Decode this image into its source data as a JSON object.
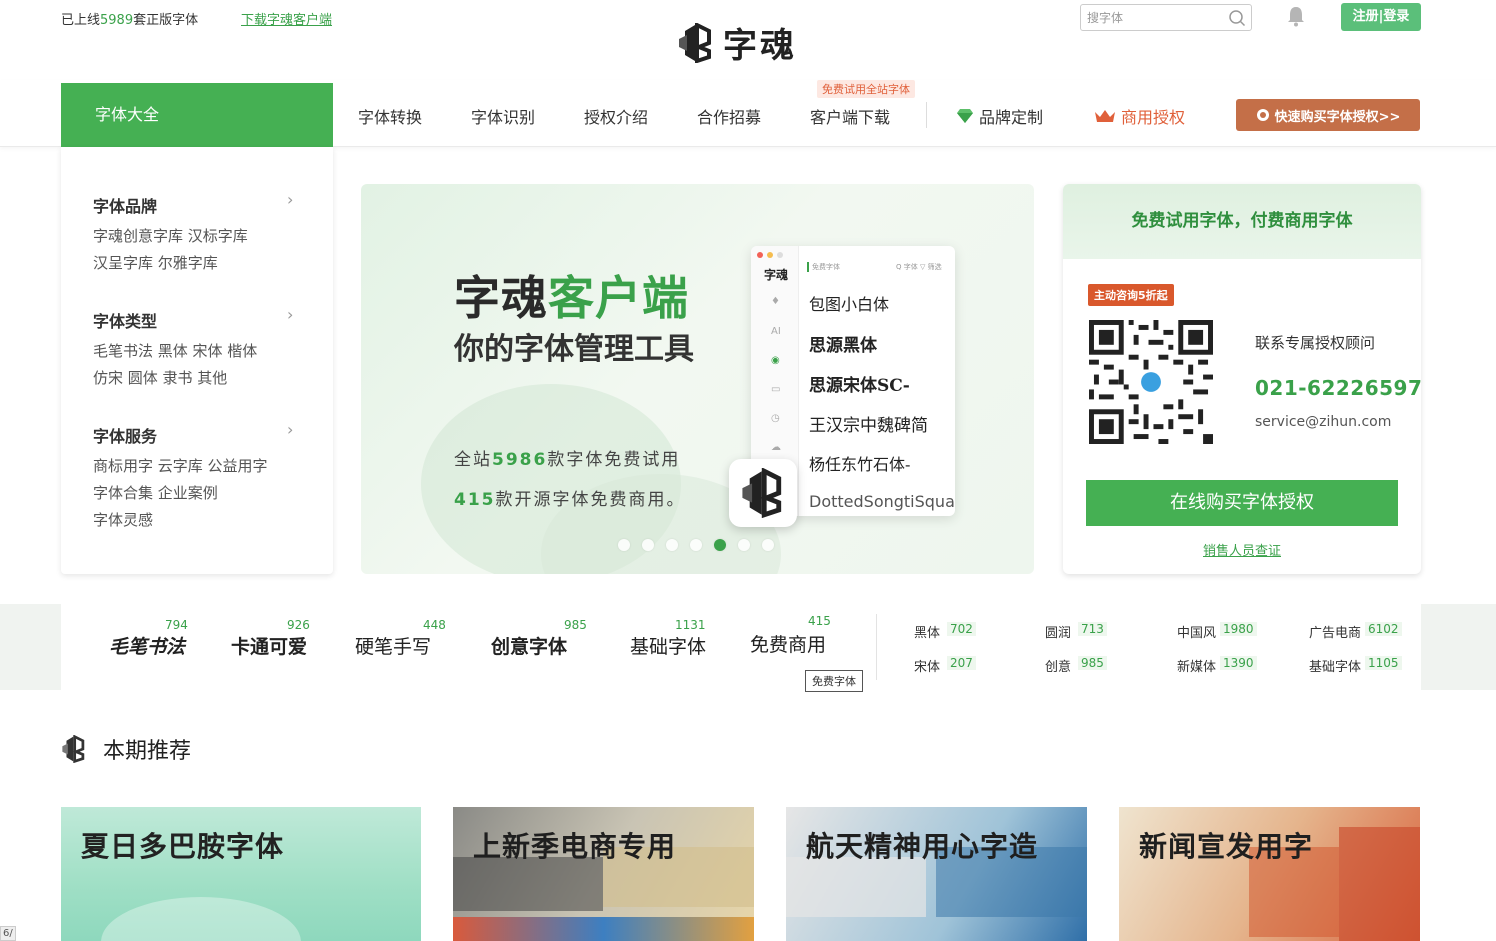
{
  "topbar": {
    "tagline_prefix": "已上线",
    "tagline_count": "5989",
    "tagline_suffix": "套正版字体",
    "download_link": "下载字魂客户端",
    "logo_text": "字魂",
    "search_placeholder": "搜字体",
    "login_label": "注册|登录"
  },
  "nav": {
    "main": "字体大全",
    "items": [
      "字体转换",
      "字体识别",
      "授权介绍",
      "合作招募",
      "客户端下载"
    ],
    "badge": "免费试用全站字体",
    "brand": "品牌定制",
    "commercial": "商用授权",
    "buy": "快速购买字体授权>>"
  },
  "categories": [
    {
      "title": "字体品牌",
      "lines": [
        "字魂创意字库 汉标字库",
        "汉呈字库 尔雅字库"
      ]
    },
    {
      "title": "字体类型",
      "lines": [
        "毛笔书法 黑体 宋体 楷体",
        "仿宋 圆体 隶书 其他"
      ]
    },
    {
      "title": "字体服务",
      "lines": [
        "商标用字 云字库 公益用字",
        "字体合集 企业案例",
        "字体灵感"
      ]
    }
  ],
  "banner": {
    "title_a": "字魂",
    "title_b": "客户端",
    "subtitle": "你的字体管理工具",
    "line1_a": "全站",
    "line1_num": "5986",
    "line1_b": "款字体免费试用",
    "line2_num": "415",
    "line2_b": "款开源字体免费商用。",
    "mock": {
      "logo": "字魂",
      "tab": "免费字体",
      "tab2": "Q 字体 ▽ 筛选",
      "sidebar_icons": [
        "♦",
        "AI",
        "◉",
        "▭",
        "◷",
        "☁"
      ],
      "rows": [
        "包图小白体",
        "思源黑体",
        "思源宋体SC-",
        "王汉宗中魏碑简",
        "杨任东竹石体-",
        "DottedSongtiSquar"
      ]
    },
    "active_slide": 5,
    "slide_count": 7
  },
  "card": {
    "header": "免费试用字体，付费商用字体",
    "tag": "主动咨询5折起",
    "label": "联系专属授权顾问",
    "phone": "021-62226597",
    "email": "service@zihun.com",
    "button": "在线购买字体授权",
    "verify": "销售人员查证"
  },
  "strip": {
    "styles": [
      {
        "name": "毛笔书法",
        "count": "794"
      },
      {
        "name": "卡通可爱",
        "count": "926"
      },
      {
        "name": "硬笔手写",
        "count": "448"
      },
      {
        "name": "创意字体",
        "count": "985"
      },
      {
        "name": "基础字体",
        "count": "1131"
      },
      {
        "name": "免费商用",
        "count": "415"
      }
    ],
    "tooltip": "免费字体",
    "types": [
      {
        "name": "黑体",
        "count": "702"
      },
      {
        "name": "圆润",
        "count": "713"
      },
      {
        "name": "中国风",
        "count": "1980"
      },
      {
        "name": "广告电商",
        "count": "6102"
      },
      {
        "name": "宋体",
        "count": "207"
      },
      {
        "name": "创意",
        "count": "985"
      },
      {
        "name": "新媒体",
        "count": "1390"
      },
      {
        "name": "基础字体",
        "count": "1105"
      }
    ]
  },
  "recommend": {
    "title": "本期推荐",
    "cards": [
      {
        "title": "夏日多巴胺字体"
      },
      {
        "title": "上新季电商专用"
      },
      {
        "title": "航天精神用心字造"
      },
      {
        "title": "新闻宣发用字"
      }
    ]
  },
  "corner_tag": "6/"
}
